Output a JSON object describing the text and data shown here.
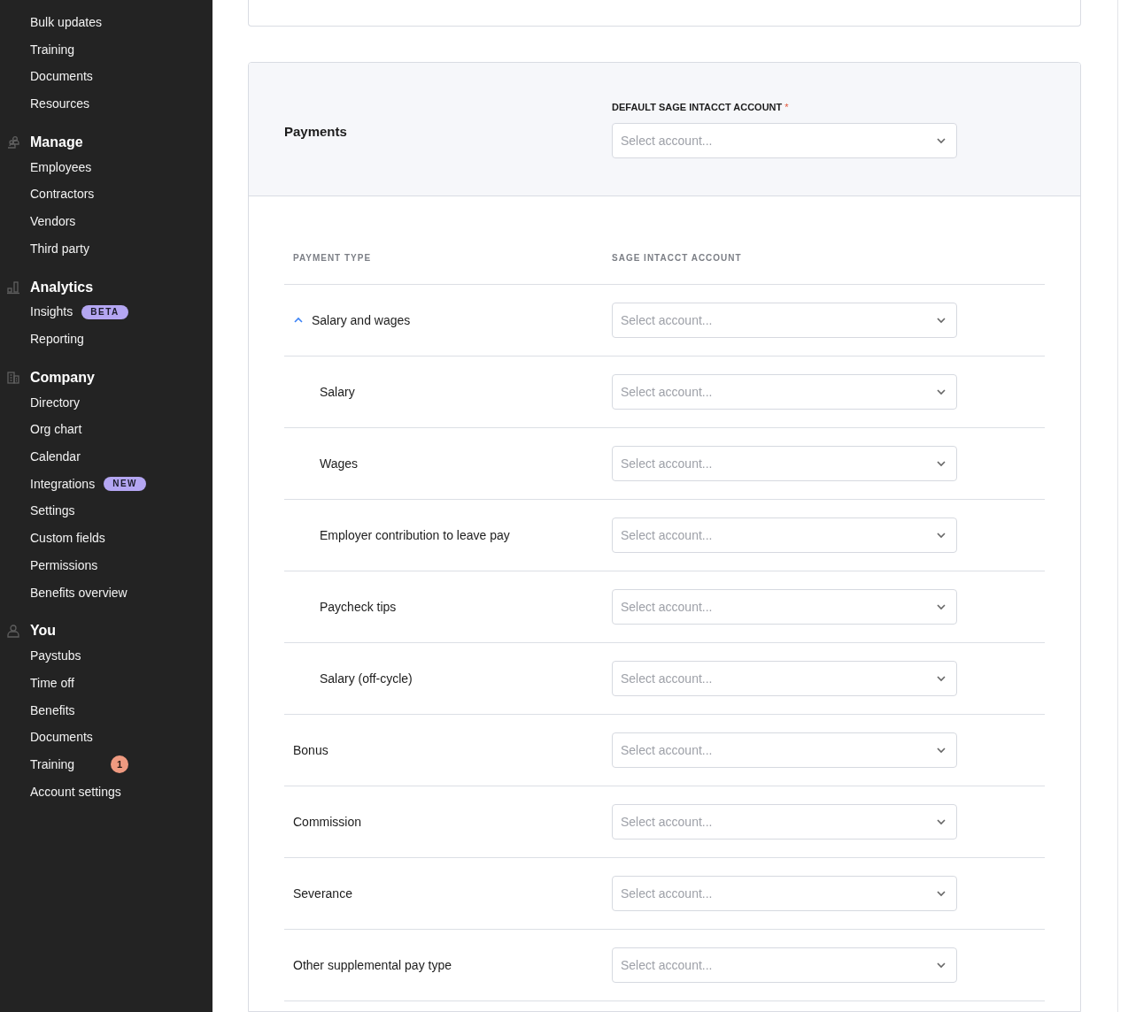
{
  "sidebar": {
    "sections": [
      {
        "items": [
          {
            "label": "Bulk updates"
          },
          {
            "label": "Training"
          },
          {
            "label": "Documents"
          },
          {
            "label": "Resources"
          }
        ]
      },
      {
        "kind": "manage",
        "title": "Manage",
        "items": [
          {
            "label": "Employees"
          },
          {
            "label": "Contractors"
          },
          {
            "label": "Vendors"
          },
          {
            "label": "Third party"
          }
        ]
      },
      {
        "kind": "analytics",
        "title": "Analytics",
        "items": [
          {
            "label": "Insights",
            "tag": "BETA"
          },
          {
            "label": "Reporting"
          }
        ]
      },
      {
        "kind": "company",
        "title": "Company",
        "items": [
          {
            "label": "Directory"
          },
          {
            "label": "Org chart"
          },
          {
            "label": "Calendar"
          },
          {
            "label": "Integrations",
            "tag": "NEW"
          },
          {
            "label": "Settings"
          },
          {
            "label": "Custom fields"
          },
          {
            "label": "Permissions"
          },
          {
            "label": "Benefits overview"
          }
        ]
      },
      {
        "kind": "you",
        "title": "You",
        "items": [
          {
            "label": "Paystubs"
          },
          {
            "label": "Time off"
          },
          {
            "label": "Benefits"
          },
          {
            "label": "Documents"
          },
          {
            "label": "Training",
            "count": "1"
          },
          {
            "label": "Account settings"
          }
        ]
      }
    ]
  },
  "payments": {
    "title": "Payments",
    "default_account": {
      "label": "DEFAULT SAGE INTACCT ACCOUNT",
      "required": true,
      "required_mark": "*",
      "placeholder": "Select account..."
    },
    "table": {
      "columns": [
        "PAYMENT TYPE",
        "SAGE INTACCT ACCOUNT"
      ],
      "rows": [
        {
          "label": "Salary and wages",
          "placeholder": "Select account...",
          "expanded": true,
          "children": [
            {
              "label": "Salary",
              "placeholder": "Select account..."
            },
            {
              "label": "Wages",
              "placeholder": "Select account..."
            },
            {
              "label": "Employer contribution to leave pay",
              "placeholder": "Select account..."
            },
            {
              "label": "Paycheck tips",
              "placeholder": "Select account..."
            },
            {
              "label": "Salary (off-cycle)",
              "placeholder": "Select account..."
            }
          ]
        },
        {
          "label": "Bonus",
          "placeholder": "Select account..."
        },
        {
          "label": "Commission",
          "placeholder": "Select account..."
        },
        {
          "label": "Severance",
          "placeholder": "Select account..."
        },
        {
          "label": "Other supplemental pay type",
          "placeholder": "Select account..."
        }
      ]
    }
  }
}
